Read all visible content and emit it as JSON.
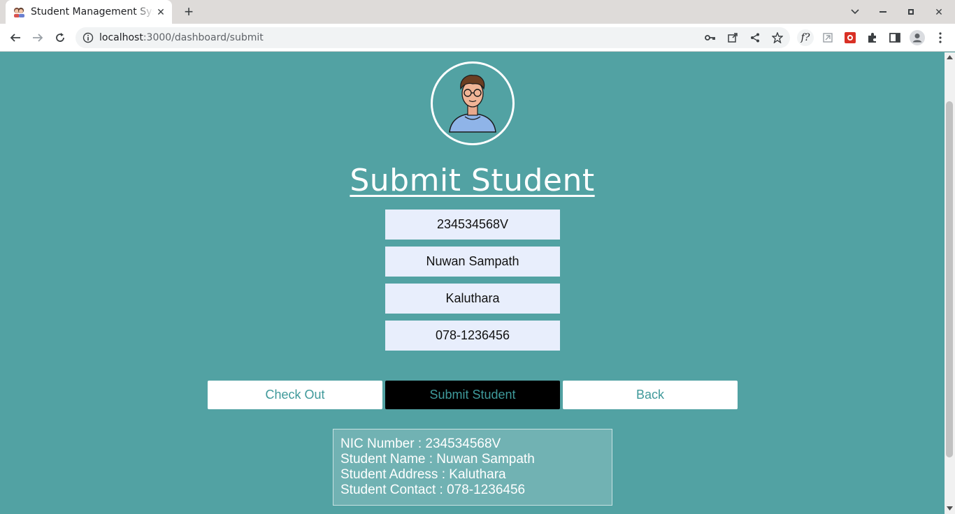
{
  "browser": {
    "tab_title": "Student Management System",
    "url_host": "localhost",
    "url_path": ":3000/dashboard/submit"
  },
  "page": {
    "title": "Submit Student",
    "fields": {
      "nic": "234534568V",
      "name": "Nuwan Sampath",
      "address": "Kaluthara",
      "contact": "078-1236456"
    },
    "buttons": {
      "checkout": "Check Out",
      "submit": "Submit Student",
      "back": "Back"
    },
    "info": {
      "nic_line": "NIC Number : 234534568V",
      "name_line": "Student Name : Nuwan Sampath",
      "address_line": "Student Address : Kaluthara",
      "contact_line": "Student Contact : 078-1236456"
    }
  },
  "colors": {
    "page_bg": "#52a2a3",
    "field_bg": "#e8eefc",
    "button_text": "#3f999a"
  }
}
